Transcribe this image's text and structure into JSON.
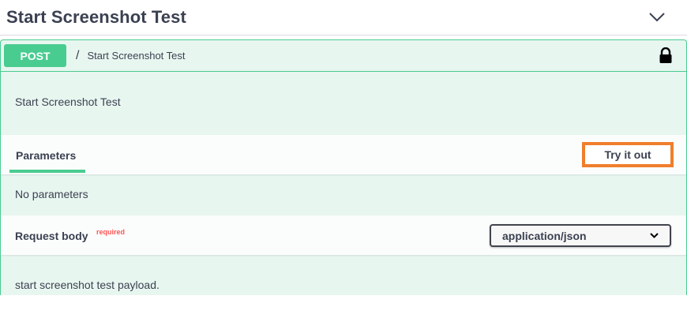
{
  "tag": {
    "title": "Start Screenshot Test",
    "toggle_icon": "chevron-down-icon"
  },
  "operation": {
    "method": "POST",
    "path_separator": "/",
    "path": "Start Screenshot Test",
    "lock_icon": "lock-icon",
    "description": "Start Screenshot Test"
  },
  "parameters": {
    "tab_label": "Parameters",
    "try_button_label": "Try it out",
    "empty_text": "No parameters"
  },
  "request_body": {
    "title": "Request body",
    "required_label": "required",
    "content_type": "application/json",
    "description": "start screenshot test payload."
  },
  "colors": {
    "method_post": "#49cc90",
    "opblock_bg": "#e8f6f0",
    "highlight": "#f07e2c",
    "required": "#ff5555",
    "text": "#3b4151"
  }
}
